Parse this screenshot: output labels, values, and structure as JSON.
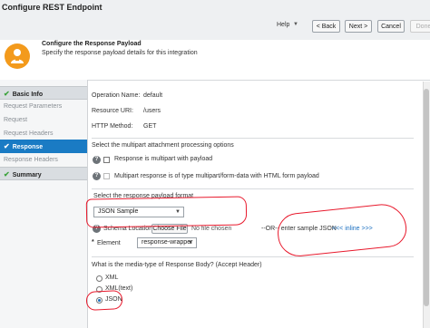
{
  "window": {
    "title": "Configure REST Endpoint",
    "help_label": "Help",
    "back_label": "< Back",
    "next_label": "Next >",
    "cancel_label": "Cancel",
    "done_label": "Done"
  },
  "header": {
    "title": "Configure the Response Payload",
    "subtitle": "Specify the response payload details for this integration"
  },
  "sidebar": {
    "items": [
      {
        "label": "Basic Info"
      },
      {
        "label": "Request Parameters"
      },
      {
        "label": "Request"
      },
      {
        "label": "Request Headers"
      },
      {
        "label": "Response"
      },
      {
        "label": "Response Headers"
      },
      {
        "label": "Summary"
      }
    ]
  },
  "info": {
    "operation_name_label": "Operation Name:",
    "operation_name_value": "default",
    "resource_uri_label": "Resource URI:",
    "resource_uri_value": "/users",
    "http_method_label": "HTTP Method:",
    "http_method_value": "GET"
  },
  "multipart": {
    "heading": "Select the multipart attachment processing options",
    "opt1": "Response is multipart with payload",
    "opt2": "Multipart response is of type multipart/form-data with HTML form payload"
  },
  "payload": {
    "heading": "Select the response payload format",
    "format_value": "JSON Sample",
    "schema_label": "Schema Location",
    "choose_file_label": "Choose File",
    "no_file_text": "No file chosen",
    "or_text": "--OR-- enter sample JSON",
    "inline_link": "<<< inline >>>",
    "element_label": "Element",
    "element_value": "response-wrapper"
  },
  "media": {
    "heading": "What is the media-type of Response Body? (Accept Header)",
    "options": [
      "XML",
      "XML(text)",
      "JSON"
    ],
    "selected": "JSON"
  },
  "colors": {
    "accent": "#1a7bc4",
    "annotation_red": "#e8192c",
    "header_icon": "#f39a1c"
  }
}
